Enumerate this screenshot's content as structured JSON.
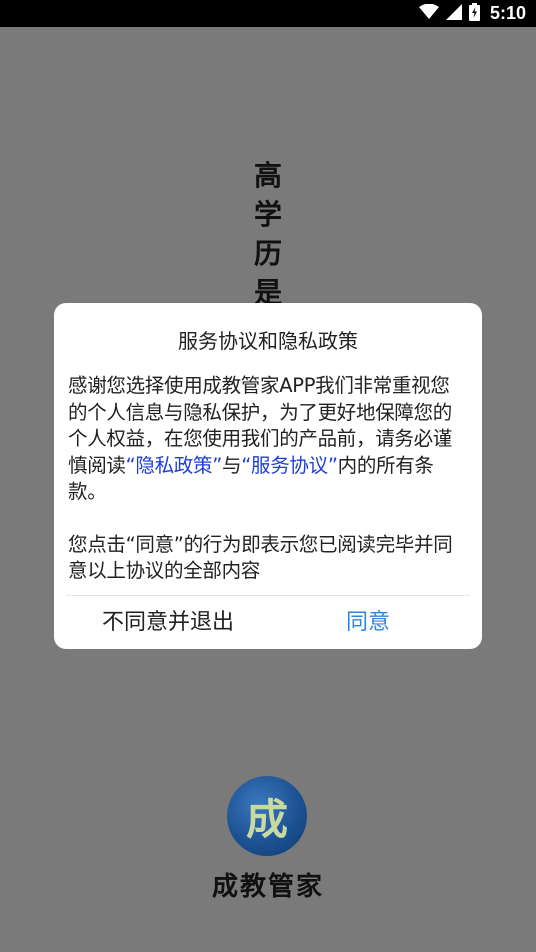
{
  "status_bar": {
    "time": "5:10",
    "icons": [
      "wifi-icon",
      "signal-icon",
      "battery-icon"
    ]
  },
  "background": {
    "slogan_chars": [
      "高",
      "学",
      "历",
      "是"
    ],
    "logo_char": "成",
    "brand_name": "成教管家"
  },
  "dialog": {
    "title": "服务协议和隐私政策",
    "para1_part1": "感谢您选择使用成教管家APP我们非常重视您的个人信息与隐私保护，为了更好地保障您的个人权益，在您使用我们的产品前，请务必谨慎阅读",
    "privacy_link": "“隐私政策”",
    "para1_connector": "与",
    "service_link": "“服务协议”",
    "para1_part2": "内的所有条款。",
    "para2": "您点击“同意”的行为即表示您已阅读完毕并同意以上协议的全部内容",
    "disagree_label": "不同意并退出",
    "agree_label": "同意"
  },
  "colors": {
    "overlay": "#7a7a7a",
    "link": "#1f3fd6",
    "agree": "#2e86de"
  }
}
